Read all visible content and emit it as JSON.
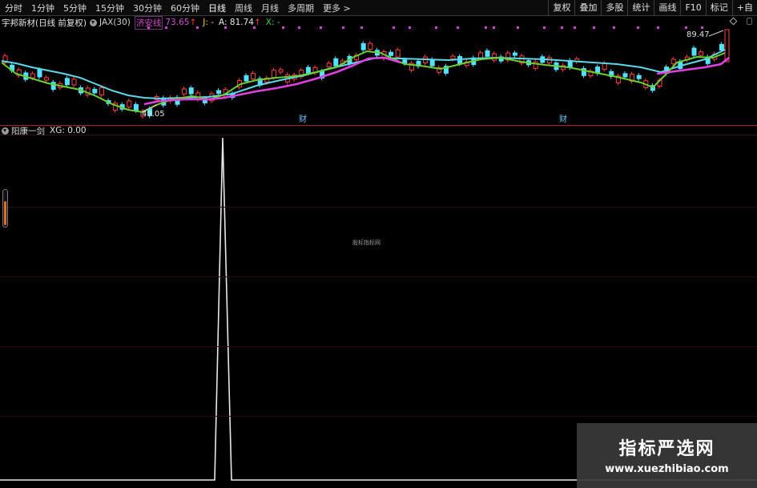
{
  "toolbar": {
    "periods": [
      "分时",
      "1分钟",
      "5分钟",
      "15分钟",
      "30分钟",
      "60分钟",
      "日线",
      "周线",
      "月线",
      "多周期",
      "更多 >"
    ],
    "active_period": "日线",
    "tools": [
      "复权",
      "叠加",
      "多股",
      "统计",
      "画线",
      "F10",
      "标记",
      "+自"
    ]
  },
  "main_header": {
    "stock_title": "宇邦新材(日线 前复权)",
    "indicator_name": "JAX(30)",
    "line_label": "济安线",
    "line_value": "73.65",
    "j_label": "J: -",
    "a_label": "A: 81.74",
    "x_label": "X: -"
  },
  "price_labels": {
    "high": "89.47",
    "low": "49.05"
  },
  "event_markers": [
    "财",
    "财"
  ],
  "sub_header": {
    "indicator_name": "阳康一剑",
    "xg_value": "XG: 0.00"
  },
  "center_label": "股标指标网",
  "watermark": {
    "title": "指标严选网",
    "url": "www.xuezhibiao.com"
  },
  "colors": {
    "up_candle": "#ff4040",
    "down_candle": "#54e0ff",
    "jax_line": "#e040e0",
    "green_line": "#68d030",
    "cyan_line": "#5cd8e8",
    "signal_line": "#e8e8e8"
  }
}
